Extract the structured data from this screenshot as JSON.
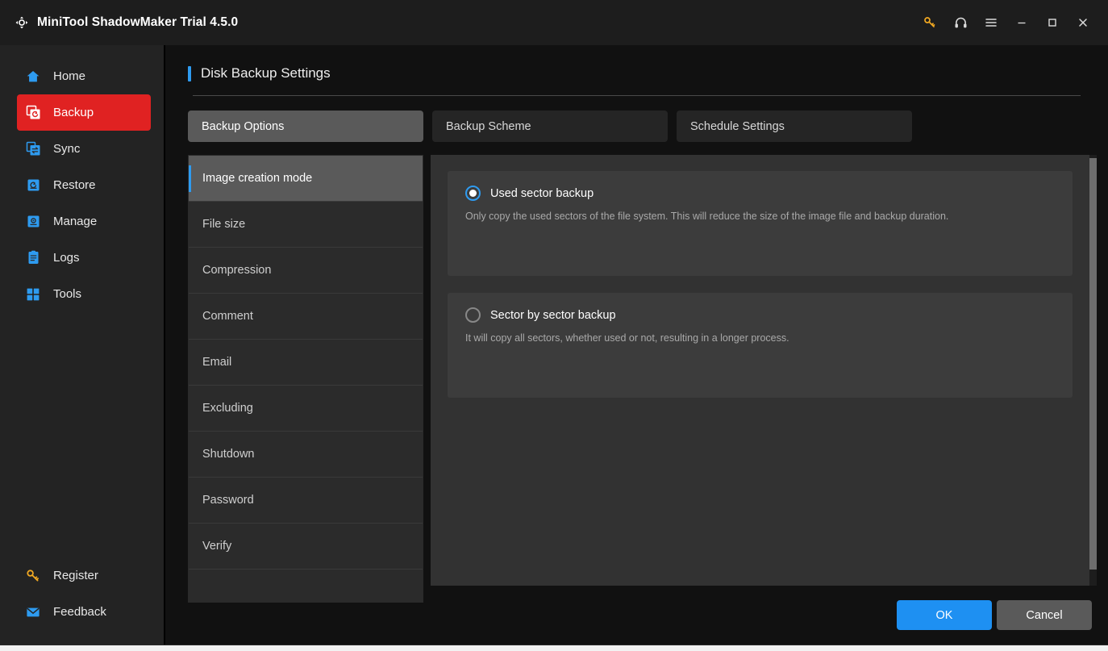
{
  "titlebar": {
    "app_title": "MiniTool ShadowMaker Trial 4.5.0",
    "logo_icon": "shadowmaker-logo-icon",
    "controls": [
      {
        "name": "register-key-icon",
        "glyph": "key"
      },
      {
        "name": "support-headset-icon",
        "glyph": "headset"
      },
      {
        "name": "menu-hamburger-icon",
        "glyph": "menu"
      },
      {
        "name": "minimize-icon",
        "glyph": "minimize"
      },
      {
        "name": "maximize-icon",
        "glyph": "maximize"
      },
      {
        "name": "close-icon",
        "glyph": "close"
      }
    ]
  },
  "sidebar": {
    "items": [
      {
        "label": "Home",
        "icon": "home-icon",
        "active": false
      },
      {
        "label": "Backup",
        "icon": "backup-icon",
        "active": true
      },
      {
        "label": "Sync",
        "icon": "sync-icon",
        "active": false
      },
      {
        "label": "Restore",
        "icon": "restore-icon",
        "active": false
      },
      {
        "label": "Manage",
        "icon": "manage-icon",
        "active": false
      },
      {
        "label": "Logs",
        "icon": "logs-icon",
        "active": false
      },
      {
        "label": "Tools",
        "icon": "tools-icon",
        "active": false
      }
    ],
    "bottom_items": [
      {
        "label": "Register",
        "icon": "key-icon"
      },
      {
        "label": "Feedback",
        "icon": "mail-icon"
      }
    ]
  },
  "page": {
    "title": "Disk Backup Settings",
    "accent_color": "#2e9bf0"
  },
  "tabs": [
    {
      "label": "Backup Options",
      "active": true
    },
    {
      "label": "Backup Scheme",
      "active": false
    },
    {
      "label": "Schedule Settings",
      "active": false
    }
  ],
  "options_list": [
    {
      "label": "Image creation mode",
      "active": true
    },
    {
      "label": "File size",
      "active": false
    },
    {
      "label": "Compression",
      "active": false
    },
    {
      "label": "Comment",
      "active": false
    },
    {
      "label": "Email",
      "active": false
    },
    {
      "label": "Excluding",
      "active": false
    },
    {
      "label": "Shutdown",
      "active": false
    },
    {
      "label": "Password",
      "active": false
    },
    {
      "label": "Verify",
      "active": false
    }
  ],
  "image_creation_mode": {
    "radios": [
      {
        "label": "Used sector backup",
        "description": "Only copy the used sectors of the file system. This will reduce the size of the image file and backup duration.",
        "checked": true
      },
      {
        "label": "Sector by sector backup",
        "description": "It will copy all sectors, whether used or not, resulting in a longer process.",
        "checked": false
      }
    ]
  },
  "footer": {
    "ok_label": "OK",
    "cancel_label": "Cancel",
    "ok_color": "#1e90f2"
  }
}
